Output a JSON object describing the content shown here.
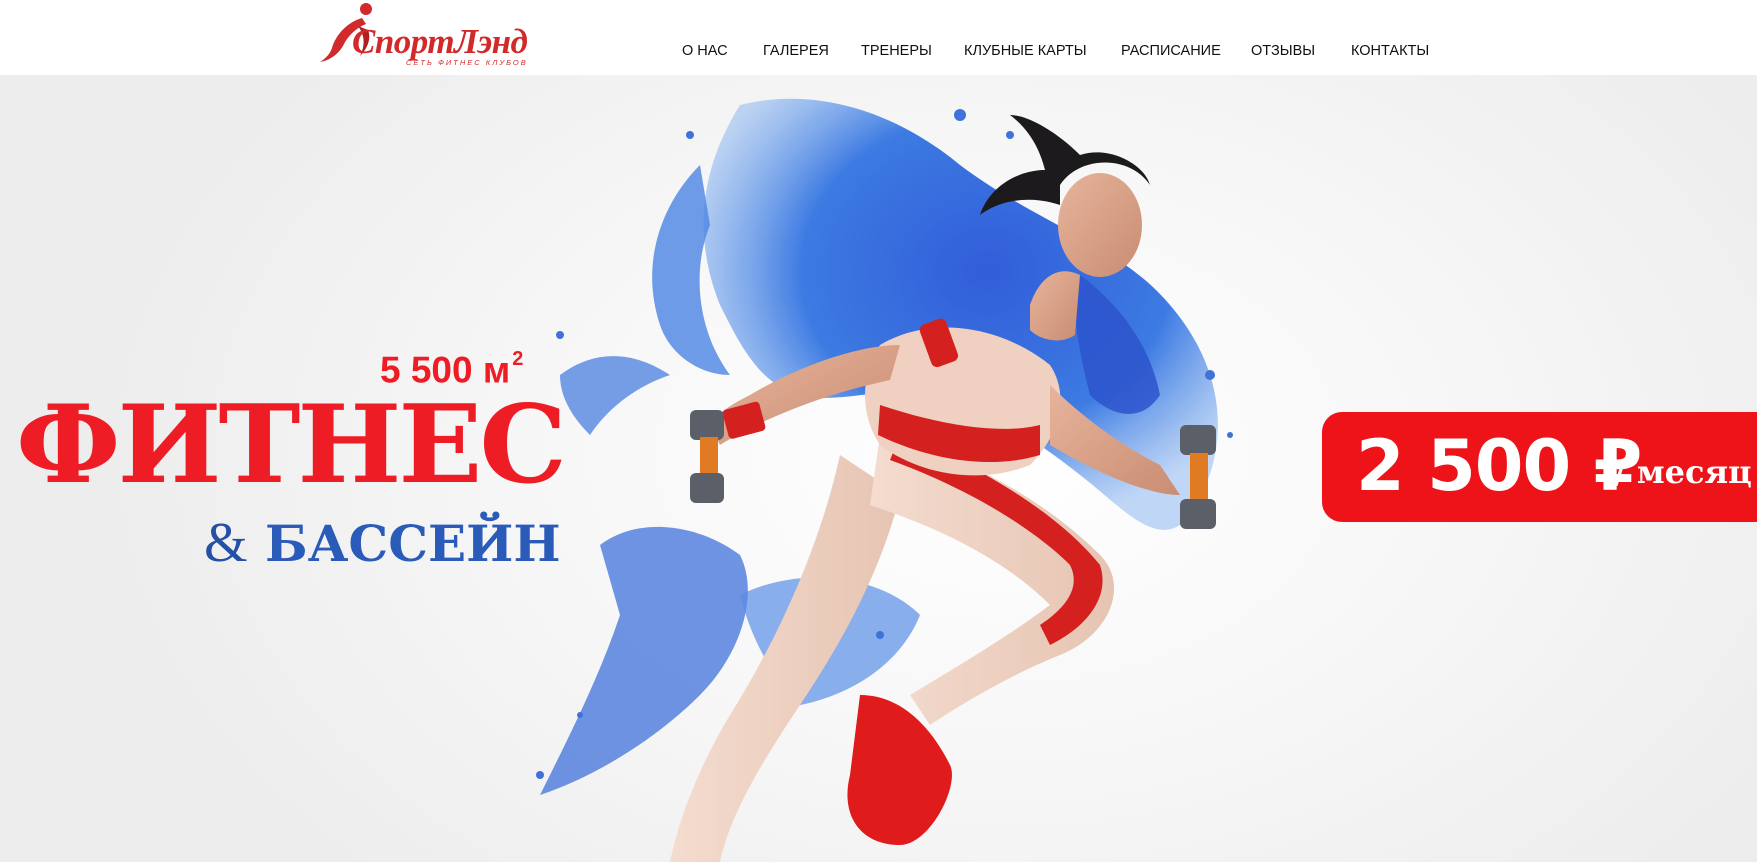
{
  "header": {
    "logo": {
      "name": "СпортЛэнд",
      "tagline": "СЕТЬ ФИТНЕС КЛУБОВ"
    },
    "nav": [
      {
        "label": "О НАС"
      },
      {
        "label": "ГАЛЕРЕЯ"
      },
      {
        "label": "ТРЕНЕРЫ"
      },
      {
        "label": "КЛУБНЫЕ КАРТЫ"
      },
      {
        "label": "РАСПИСАНИЕ"
      },
      {
        "label": "ОТЗЫВЫ"
      },
      {
        "label": "КОНТАКТЫ"
      }
    ]
  },
  "hero": {
    "area": "5 500 м",
    "area_sup": "2",
    "title_main": "ФИТНЕС",
    "title_amp": "&",
    "title_pool": "БАССЕЙН",
    "price_amount": "2 500 ₽",
    "price_period": "/ месяц"
  },
  "colors": {
    "brand_red": "#ee1c25",
    "pool_blue": "#2a5bb8",
    "logo_red": "#d22a2a"
  }
}
